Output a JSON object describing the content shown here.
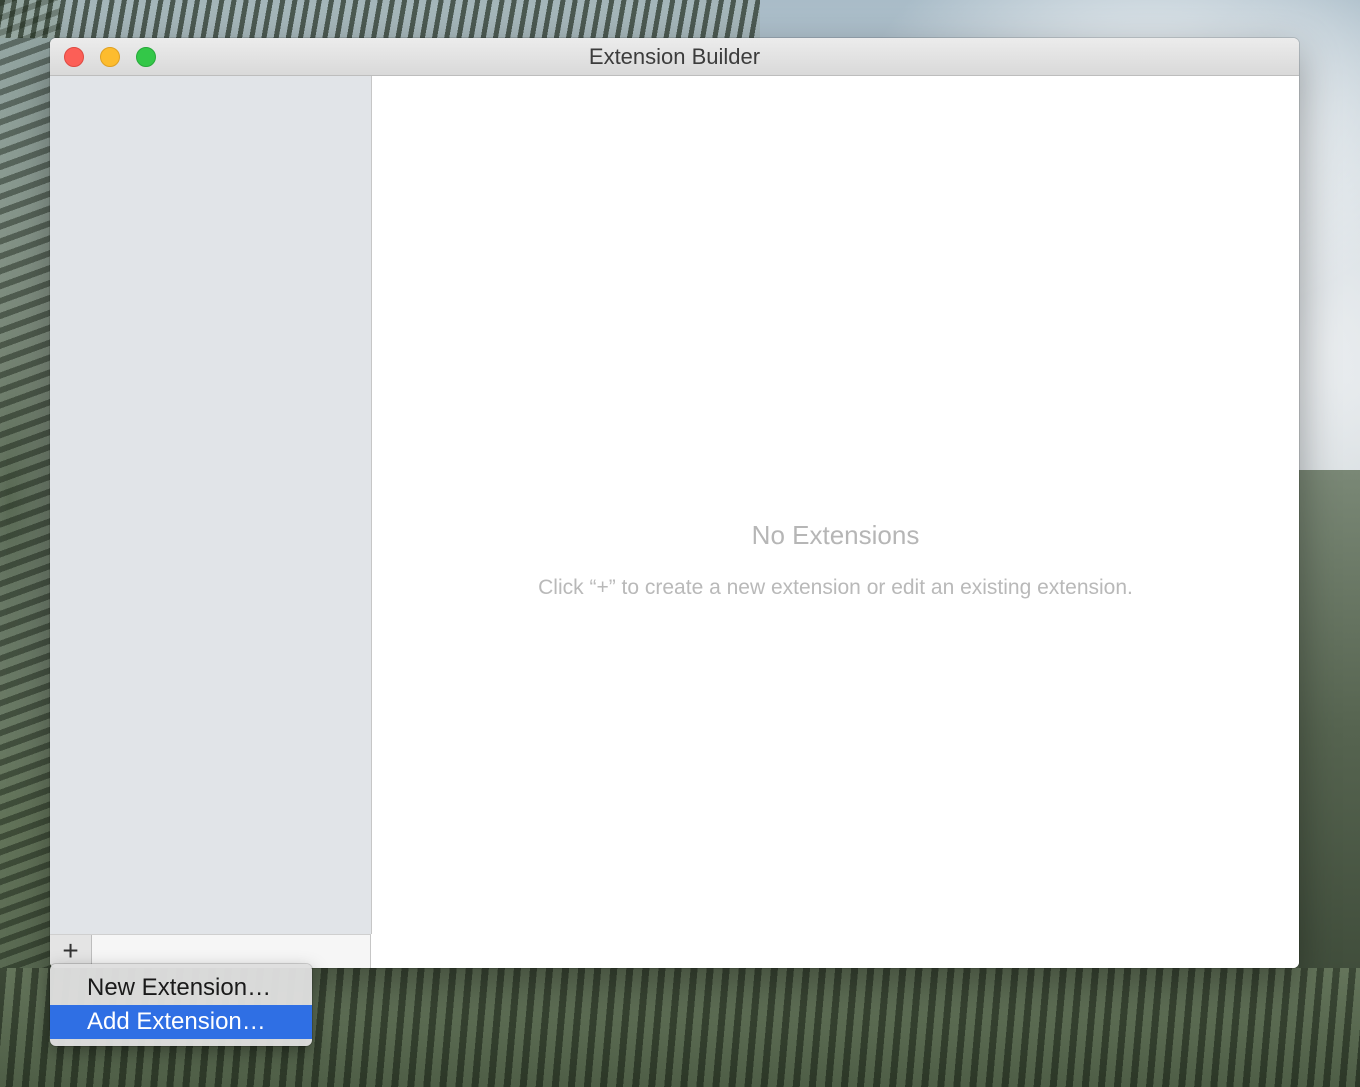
{
  "window": {
    "title": "Extension Builder"
  },
  "sidebar": {
    "add_button_label": "+"
  },
  "content": {
    "empty_title": "No Extensions",
    "empty_message": "Click “+” to create a new extension or edit an existing extension."
  },
  "popup_menu": {
    "items": [
      {
        "label": "New Extension…",
        "selected": false
      },
      {
        "label": "Add Extension…",
        "selected": true
      }
    ]
  },
  "colors": {
    "selection": "#2f6fe4",
    "close": "#fc5f57",
    "minimize": "#fdbc2e",
    "zoom": "#33c748",
    "sidebar_bg": "#e1e4e8"
  }
}
